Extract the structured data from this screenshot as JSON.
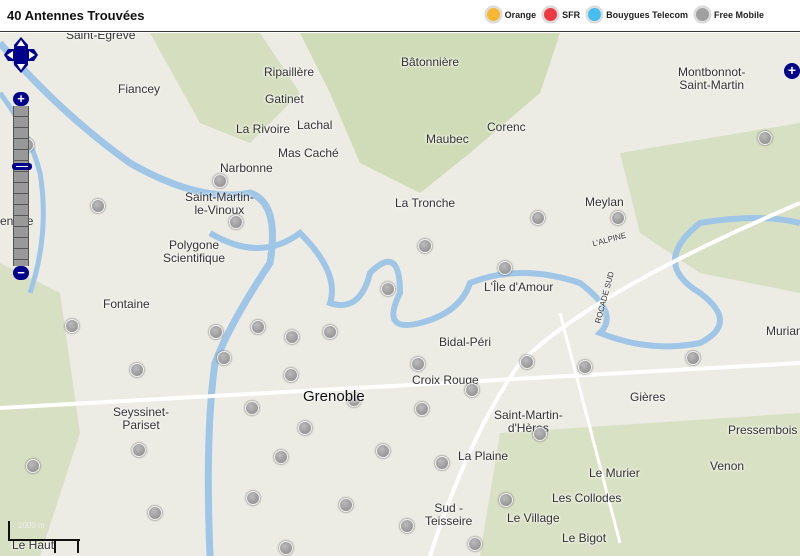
{
  "header": {
    "title": "40 Antennes Trouvées"
  },
  "legend": [
    {
      "label": "Orange",
      "color": "#f7b733"
    },
    {
      "label": "SFR",
      "color": "#ee3a43"
    },
    {
      "label": "Bouygues Telecom",
      "color": "#45bdf0"
    },
    {
      "label": "Free Mobile",
      "color": "#a0a0a0"
    }
  ],
  "map": {
    "city": "Grenoble",
    "labels": [
      "Saint-Égrève",
      "Fiancey",
      "Ripaillère",
      "Gatinet",
      "La Rivoire",
      "Lachal",
      "Mas Caché",
      "Narbonne",
      "Saint-Martin-\nle-Vinoux",
      "Polygone\nScientifique",
      "Bâtonnière",
      "Maubec",
      "Corenc",
      "Montbonnot-\nSaint-Martin",
      "La Tronche",
      "Meylan",
      "L'Île d'Amour",
      "Fontaine",
      "Bidal-Péri",
      "Croix Rouge",
      "Seyssinet-\nPariset",
      "Saint-Martin-\nd'Hères",
      "Gières",
      "Murian",
      "Pressembois",
      "La Plaine",
      "Venon",
      "Le Murier",
      "Les Collodes",
      "Le Village",
      "Sud -\nTeisseire",
      "Le Bigot",
      "Le Haut",
      "enage",
      "L'ALPINE",
      "ROCADE SUD"
    ],
    "marker_count": 40,
    "marker_color": "#a0a0a0",
    "scale": {
      "metric": "1000 m"
    }
  },
  "controls": {
    "zoom_in": "+",
    "zoom_out": "−",
    "expand": "+"
  }
}
